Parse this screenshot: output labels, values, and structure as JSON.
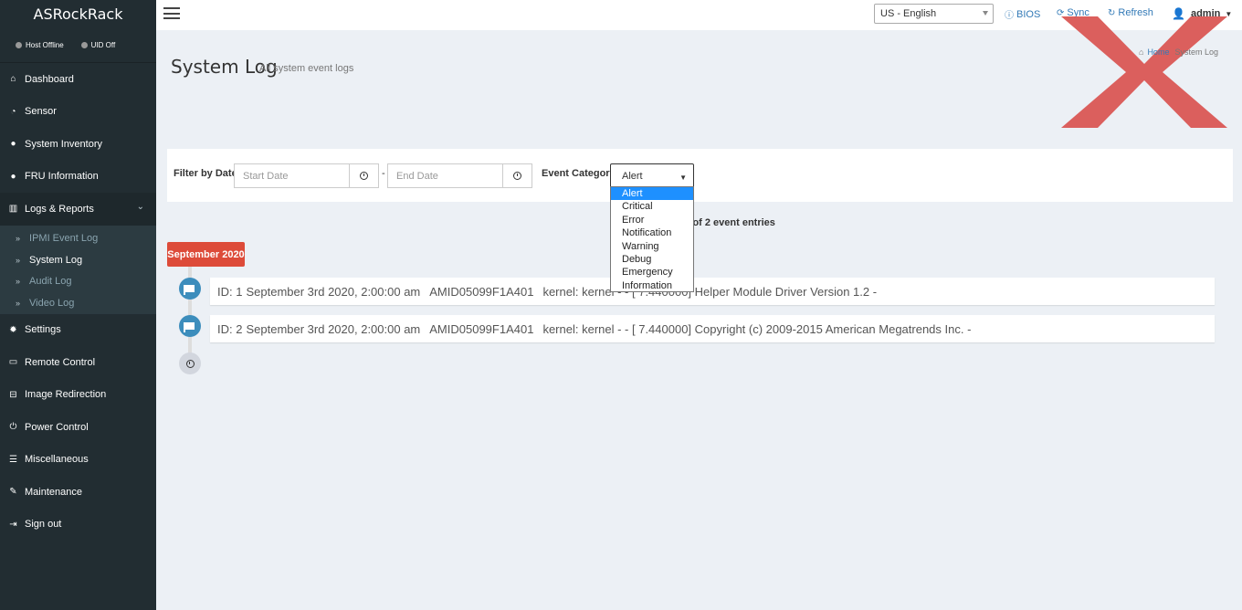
{
  "sidebar": {
    "brand": "ASRockRack",
    "status": [
      {
        "label": "Host Offline"
      },
      {
        "label": "UID Off"
      }
    ],
    "items_top": [
      {
        "label": "Dashboard",
        "icon": "home-icon"
      },
      {
        "label": "Sensor",
        "icon": "dashboard-gauge-icon"
      },
      {
        "label": "System Inventory",
        "icon": "info-circle-icon"
      },
      {
        "label": "FRU Information",
        "icon": "info-circle-icon"
      },
      {
        "label": "Logs & Reports",
        "icon": "bar-chart-icon"
      }
    ],
    "logs_sub": [
      {
        "label": "IPMI Event Log"
      },
      {
        "label": "System Log"
      },
      {
        "label": "Audit Log"
      },
      {
        "label": "Video Log"
      }
    ],
    "items_bottom": [
      {
        "label": "Settings",
        "icon": "gear-icon"
      },
      {
        "label": "Remote Control",
        "icon": "monitor-icon"
      },
      {
        "label": "Image Redirection",
        "icon": "disk-icon"
      },
      {
        "label": "Power Control",
        "icon": "power-icon"
      },
      {
        "label": "Miscellaneous",
        "icon": "list-icon"
      },
      {
        "label": "Maintenance",
        "icon": "wrench-icon"
      },
      {
        "label": "Sign out",
        "icon": "sign-out-icon"
      }
    ]
  },
  "header": {
    "language": "US - English",
    "bios": "BIOS",
    "sync": "Sync",
    "refresh": "Refresh",
    "user": "admin"
  },
  "page": {
    "title": "System Log",
    "subtitle": "All system event logs",
    "breadcrumb_home": "Home",
    "breadcrumb_current": "System Log"
  },
  "filter": {
    "date_label": "Filter by Date",
    "start_placeholder": "Start Date",
    "separator": "-",
    "end_placeholder": "End Date",
    "category_label": "Event Category",
    "category_value": "Alert",
    "category_options": [
      "Alert",
      "Critical",
      "Error",
      "Notification",
      "Warning",
      "Debug",
      "Emergency",
      "Information"
    ]
  },
  "entries_text": "nt of 2 event entries",
  "timeline": {
    "label": "September 2020",
    "items": [
      {
        "id": "ID: 1",
        "date": "September 3rd 2020, 2:00:00 am",
        "host": "AMID05099F1A401",
        "message": "kernel: kernel - - [ 7.440000] Helper Module Driver Version 1.2 -"
      },
      {
        "id": "ID: 2",
        "date": "September 3rd 2020, 2:00:00 am",
        "host": "AMID05099F1A401",
        "message": "kernel: kernel - - [ 7.440000] Copyright (c) 2009-2015 American Megatrends Inc. -"
      }
    ]
  },
  "colors": {
    "sidebar_bg": "#222d32",
    "accent_red": "#dd4b39",
    "timeline_blue": "#3c8dbc",
    "link_blue": "#337ab7"
  }
}
